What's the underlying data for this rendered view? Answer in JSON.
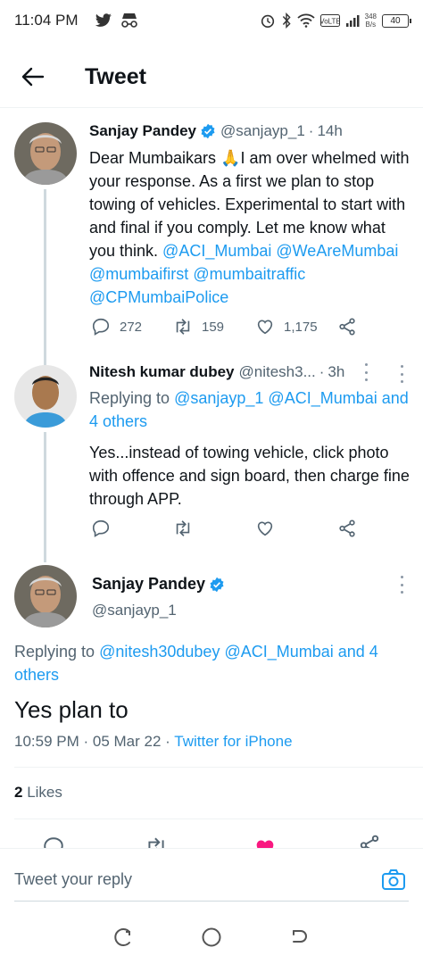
{
  "status_bar": {
    "time": "11:04 PM",
    "net_speed_top": "348",
    "net_speed_bottom": "B/s",
    "battery": "40",
    "icons": [
      "twitter-bird-icon",
      "incognito-icon",
      "alarm-icon",
      "bluetooth-icon",
      "wifi-icon",
      "volte-icon",
      "signal-icon"
    ]
  },
  "header": {
    "title": "Tweet",
    "back_icon": "arrow-left-icon"
  },
  "tweets": [
    {
      "name": "Sanjay Pandey",
      "handle": "@sanjayp_1",
      "time": "14h",
      "verified": true,
      "text_parts": [
        "Dear Mumbaikars ",
        "🙏",
        "I am over whelmed with your response. As a first we plan to stop towing of vehicles. Experimental to start with and final if you comply. Let me know what you think. "
      ],
      "mentions": [
        "@ACI_Mumbai",
        "@WeAreMumbai",
        "@mumbaifirst",
        "@mumbaitraffic",
        "@CPMumbaiPolice"
      ],
      "replies": "272",
      "retweets": "159",
      "likes": "1,175"
    },
    {
      "name": "Nitesh kumar dubey",
      "handle": "@nitesh3...",
      "time": "3h",
      "verified": false,
      "replying_label": "Replying to",
      "replying_mentions": "@sanjayp_1 @ACI_Mumbai and 4 others",
      "text": "Yes...instead of towing vehicle, click photo with offence and sign board, then charge fine through APP."
    }
  ],
  "focused_tweet": {
    "name": "Sanjay Pandey",
    "handle": "@sanjayp_1",
    "verified": true,
    "replying_label": "Replying to",
    "replying_mentions": "@nitesh30dubey @ACI_Mumbai and 4 others",
    "text": "Yes plan to",
    "time": "10:59 PM",
    "date": "05 Mar 22",
    "source": "Twitter for iPhone",
    "likes_count": "2",
    "likes_label": "Likes"
  },
  "reply_bar": {
    "placeholder": "Tweet your reply",
    "camera_icon": "camera-icon"
  },
  "nav_bar": {
    "buttons": [
      "recents-icon",
      "home-circle-icon",
      "back-nav-icon"
    ]
  },
  "colors": {
    "accent": "#1d9bf0",
    "like_active": "#f91880",
    "text": "#0f1419",
    "muted": "#536471"
  }
}
